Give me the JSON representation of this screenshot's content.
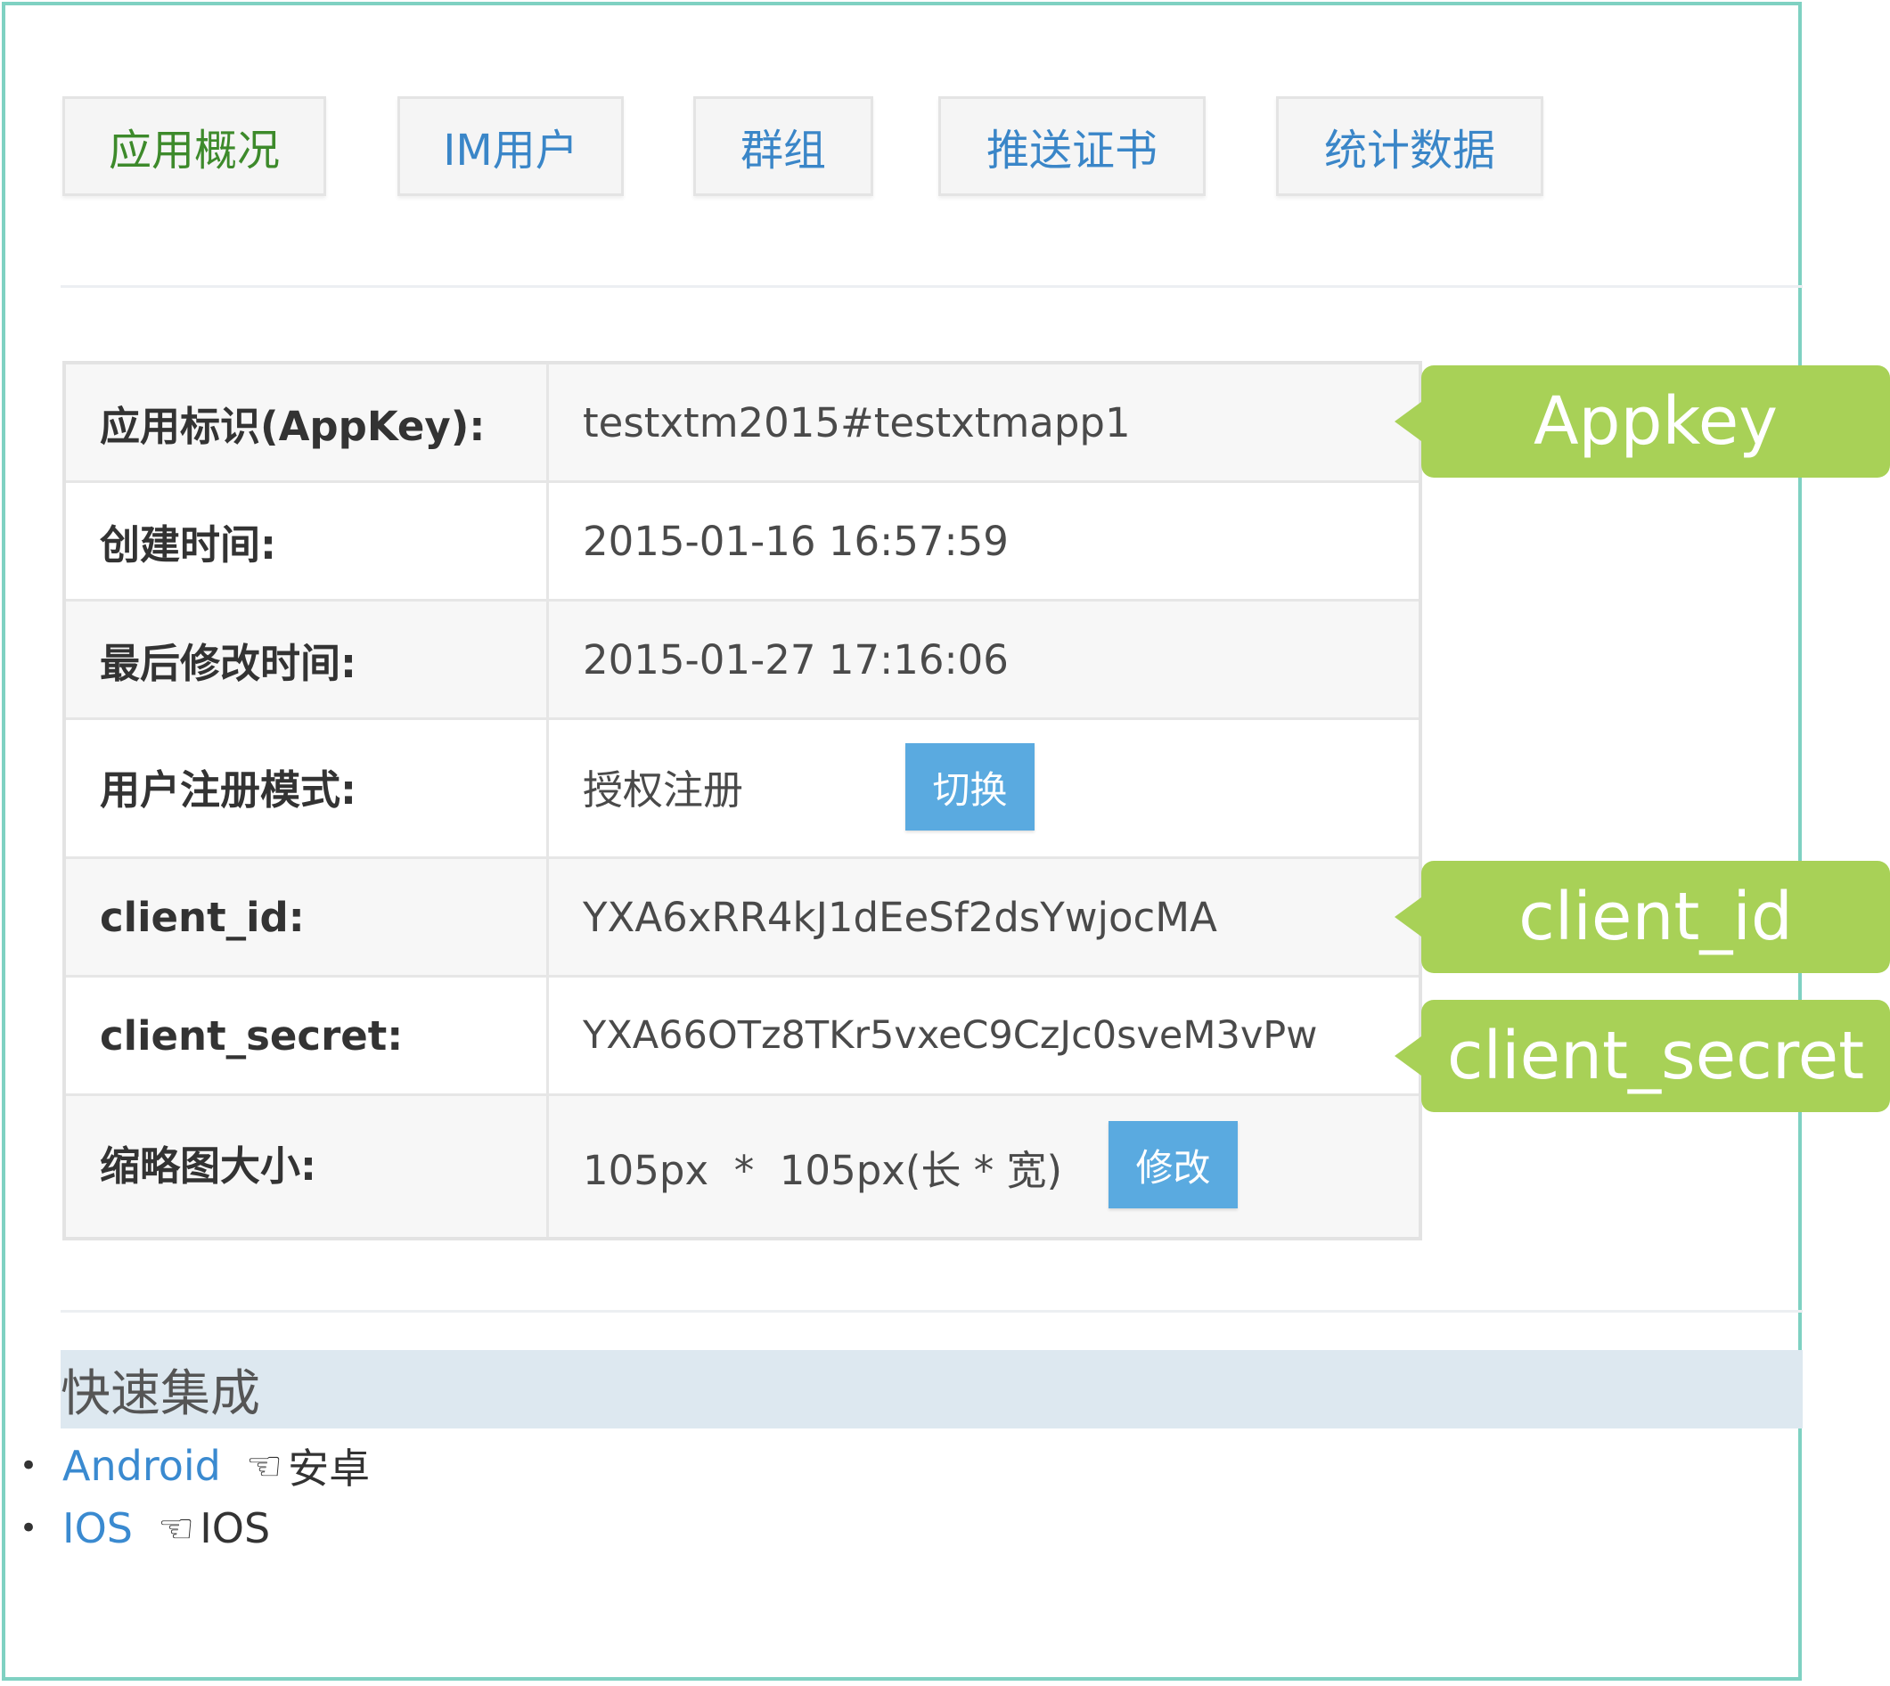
{
  "tabs": [
    {
      "label": "应用概况"
    },
    {
      "label": "IM用户"
    },
    {
      "label": "群组"
    },
    {
      "label": "推送证书"
    },
    {
      "label": "统计数据"
    }
  ],
  "info_table": {
    "rows": [
      {
        "label": "应用标识(AppKey):",
        "value": "testxtm2015#testxtmapp1"
      },
      {
        "label": "创建时间:",
        "value": "2015-01-16 16:57:59"
      },
      {
        "label": "最后修改时间:",
        "value": "2015-01-27 17:16:06"
      },
      {
        "label": "用户注册模式:",
        "value": "授权注册",
        "button": "切换"
      },
      {
        "label": "client_id:",
        "value": "YXA6xRR4kJ1dEeSf2dsYwjocMA"
      },
      {
        "label": "client_secret:",
        "value": "YXA66OTz8TKr5vxeC9CzJc0sveM3vPw"
      },
      {
        "label": "缩略图大小:",
        "value": "105px  *  105px(长 * 宽)",
        "button": "修改"
      }
    ]
  },
  "callouts": {
    "appkey": "Appkey",
    "client_id": "client_id",
    "client_secret": "client_secret"
  },
  "quick_integration": {
    "title": "快速集成",
    "items": [
      {
        "link": "Android",
        "hand_icon": "hand-pointer-icon",
        "label": "安卓"
      },
      {
        "link": "IOS",
        "hand_icon": "hand-pointer-icon",
        "label": "IOS"
      }
    ]
  },
  "colors": {
    "frame": "#7fd1c2",
    "callout": "#a8d157",
    "button": "#5aaae0",
    "link": "#3a8ad0",
    "active_tab": "#3d8a2b"
  }
}
